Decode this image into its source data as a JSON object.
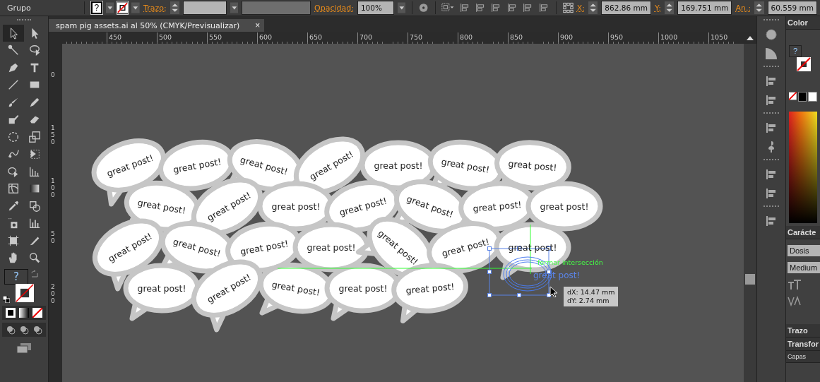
{
  "control_bar": {
    "selection_label": "Grupo",
    "fill_swatch": "?",
    "stroke_label": "Trazo:",
    "opacity_label": "Opacidad:",
    "opacity_value": "100%",
    "x_label": "X:",
    "x_value": "862.86 mm",
    "y_label": "Y:",
    "y_value": "169.751 mm",
    "width_label": "An.:",
    "width_value": "60.559 mm"
  },
  "document_tab": {
    "title": "spam pig assets.ai al 50% (CMYK/Previsualizar)",
    "close": "×"
  },
  "horizontal_ruler": [
    "450",
    "500",
    "550",
    "600",
    "650",
    "700",
    "750",
    "800",
    "850",
    "900",
    "950",
    "1000",
    "1050"
  ],
  "vertical_ruler": [
    "0",
    "150",
    "100",
    "50",
    "200"
  ],
  "tools": [
    {
      "kind": "selection",
      "selected": true
    },
    {
      "kind": "direct",
      "selected": false
    },
    {
      "kind": "wand",
      "selected": false
    },
    {
      "kind": "lasso",
      "selected": false
    },
    {
      "kind": "pen",
      "selected": false
    },
    {
      "kind": "type",
      "selected": false
    },
    {
      "kind": "line",
      "selected": false
    },
    {
      "kind": "rect",
      "selected": false
    },
    {
      "kind": "brush",
      "selected": false
    },
    {
      "kind": "pencil",
      "selected": false
    },
    {
      "kind": "blob",
      "selected": false
    },
    {
      "kind": "eraser",
      "selected": false
    },
    {
      "kind": "rotate",
      "selected": false
    },
    {
      "kind": "scale",
      "selected": false
    },
    {
      "kind": "warp",
      "selected": false
    },
    {
      "kind": "free",
      "selected": false
    },
    {
      "kind": "shape",
      "selected": false
    },
    {
      "kind": "grid",
      "selected": false
    },
    {
      "kind": "mesh",
      "selected": false
    },
    {
      "kind": "gradient",
      "selected": false
    },
    {
      "kind": "eyedropper",
      "selected": false
    },
    {
      "kind": "blend",
      "selected": false
    },
    {
      "kind": "spray",
      "selected": false
    },
    {
      "kind": "graph",
      "selected": false
    },
    {
      "kind": "artboard",
      "selected": false
    },
    {
      "kind": "slice",
      "selected": false
    },
    {
      "kind": "hand",
      "selected": false
    },
    {
      "kind": "zoom",
      "selected": false
    }
  ],
  "fill_stroke": {
    "fill_swatch": "?"
  },
  "canvas": {
    "bubbles": [
      {
        "text": "great post!"
      },
      {
        "text": "great post!"
      },
      {
        "text": "great post!"
      },
      {
        "text": "great post!"
      },
      {
        "text": "great post!"
      },
      {
        "text": "great post!"
      },
      {
        "text": "great post!"
      },
      {
        "text": "great post!"
      },
      {
        "text": "great post!"
      },
      {
        "text": "great post!"
      },
      {
        "text": "great post!"
      },
      {
        "text": "great post!"
      },
      {
        "text": "great post!"
      },
      {
        "text": "great post!"
      },
      {
        "text": "great post!"
      },
      {
        "text": "great post!"
      },
      {
        "text": "great post!"
      },
      {
        "text": "great post!"
      },
      {
        "text": "great post!"
      },
      {
        "text": "great post!"
      },
      {
        "text": "great post!"
      },
      {
        "text": "great post!"
      },
      {
        "text": "great post!"
      },
      {
        "text": "great post!"
      },
      {
        "text": "great post!"
      },
      {
        "text": "great post!"
      }
    ],
    "ghost_text": "great post!",
    "smart_guide_label": "formar intersección",
    "tooltip": [
      "dX: 14.47 mm",
      "dY: 2.74 mm"
    ]
  },
  "right_panel": {
    "color_title": "Color",
    "fill_swatch": "?",
    "character_title": "Carácte",
    "font_family": "Dosis",
    "font_style": "Medium",
    "stroke_title": "Trazo",
    "transform_title": "Transfor",
    "layers_title": "Capas"
  }
}
